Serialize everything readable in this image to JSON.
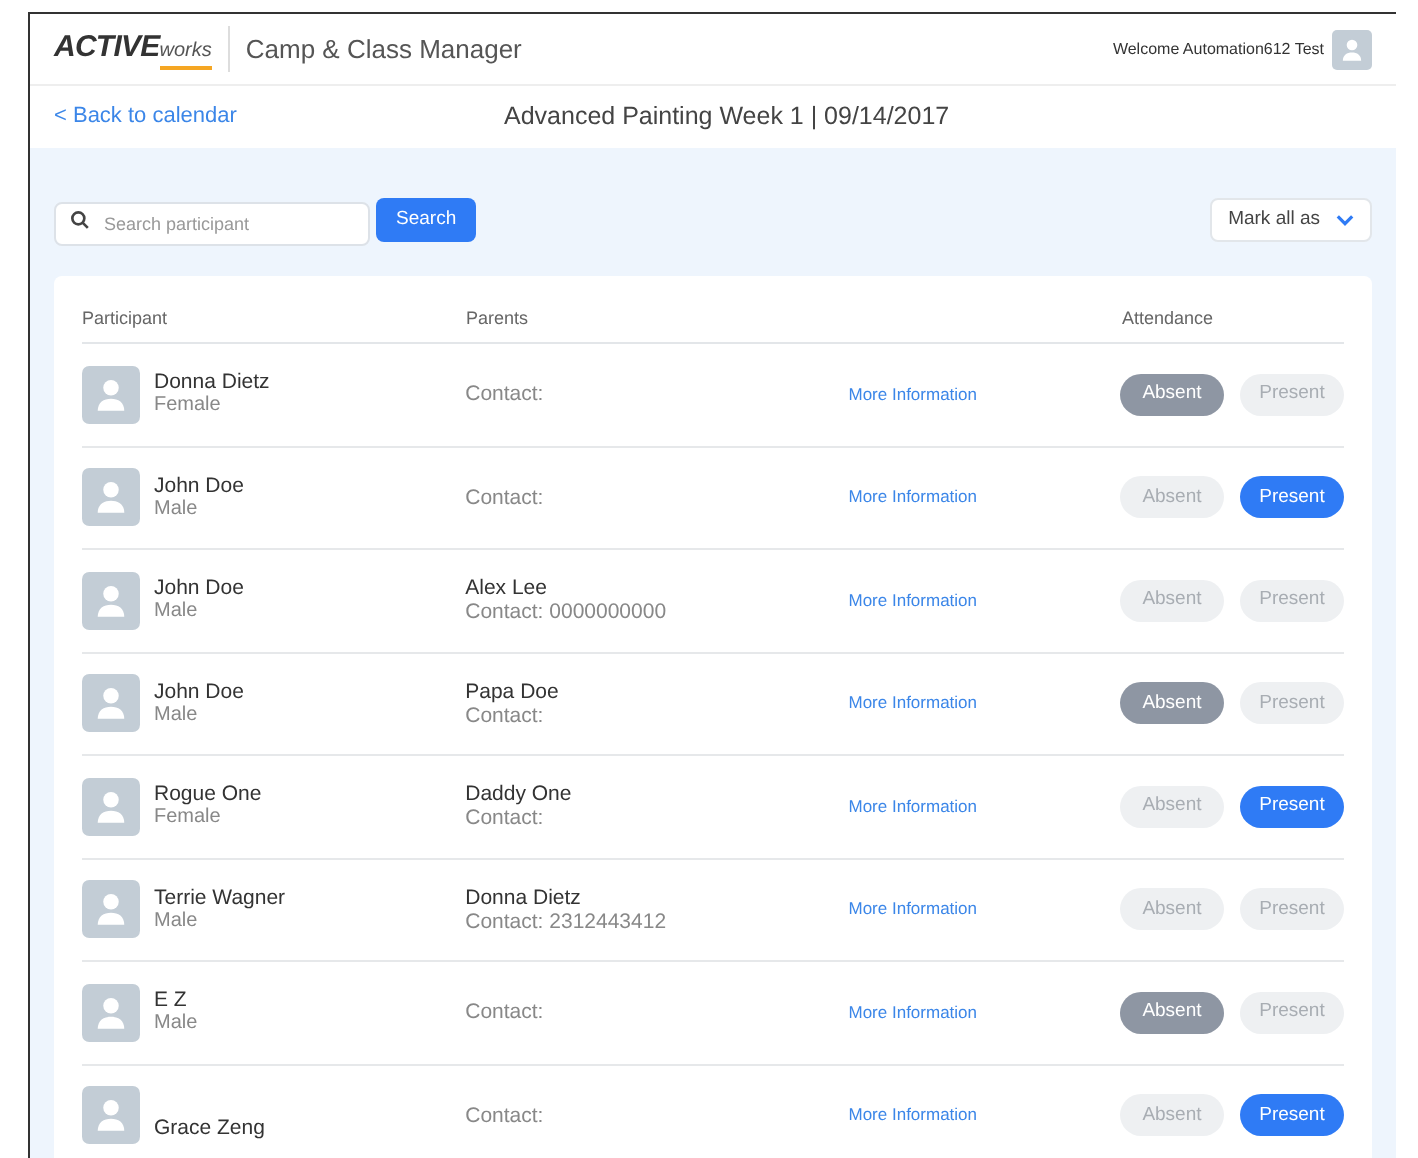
{
  "header": {
    "logo_main": "ACTIVE",
    "logo_sub": "works",
    "app_name": "Camp & Class Manager",
    "welcome": "Welcome Automation612 Test"
  },
  "nav": {
    "back_link": "< Back to calendar",
    "title": "Advanced Painting Week 1 | 09/14/2017"
  },
  "toolbar": {
    "search": {
      "placeholder": "Search participant"
    },
    "search_button": "Search",
    "mark_all": "Mark all as"
  },
  "table": {
    "columns": [
      "Participant",
      "Parents",
      "Attendance"
    ],
    "rows": [
      {
        "name": "Donna Dietz",
        "gender": "Female",
        "contact": "Contact:",
        "more": "More Information",
        "attendance": [
          {
            "label": "Absent",
            "selected": true
          },
          {
            "label": "Present",
            "selected": false
          }
        ]
      },
      {
        "name": "John Doe",
        "gender": "Male",
        "contact": "Contact:",
        "more": "More Information",
        "attendance": [
          {
            "label": "Absent",
            "selected": false
          },
          {
            "label": "Present",
            "selected": true
          }
        ]
      },
      {
        "name": "John Doe",
        "gender": "Male",
        "parent": "Alex Lee",
        "contact": "Contact: 0000000000",
        "more": "More Information",
        "attendance": [
          {
            "label": "Absent",
            "selected": false
          },
          {
            "label": "Present",
            "selected": false
          }
        ]
      },
      {
        "name": "John Doe",
        "gender": "Male",
        "parent": "Papa Doe",
        "contact": "Contact:",
        "more": "More Information",
        "attendance": [
          {
            "label": "Absent",
            "selected": true
          },
          {
            "label": "Present",
            "selected": false
          }
        ]
      },
      {
        "name": "Rogue One",
        "gender": "Female",
        "parent": "Daddy One",
        "contact": "Contact:",
        "more": "More Information",
        "attendance": [
          {
            "label": "Absent",
            "selected": false
          },
          {
            "label": "Present",
            "selected": true
          }
        ]
      },
      {
        "name": "Terrie Wagner",
        "gender": "Male",
        "parent": "Donna Dietz",
        "contact": "Contact: 2312443412",
        "more": "More Information",
        "attendance": [
          {
            "label": "Absent",
            "selected": false
          },
          {
            "label": "Present",
            "selected": false
          }
        ]
      },
      {
        "name": "E Z",
        "gender": "Male",
        "contact": "Contact:",
        "more": "More Information",
        "attendance": [
          {
            "label": "Absent",
            "selected": true
          },
          {
            "label": "Present",
            "selected": false
          }
        ]
      },
      {
        "name": "Grace Zeng",
        "contact": "Contact:",
        "more": "More Information",
        "attendance": [
          {
            "label": "Absent",
            "selected": false
          },
          {
            "label": "Present",
            "selected": true
          }
        ]
      }
    ]
  }
}
